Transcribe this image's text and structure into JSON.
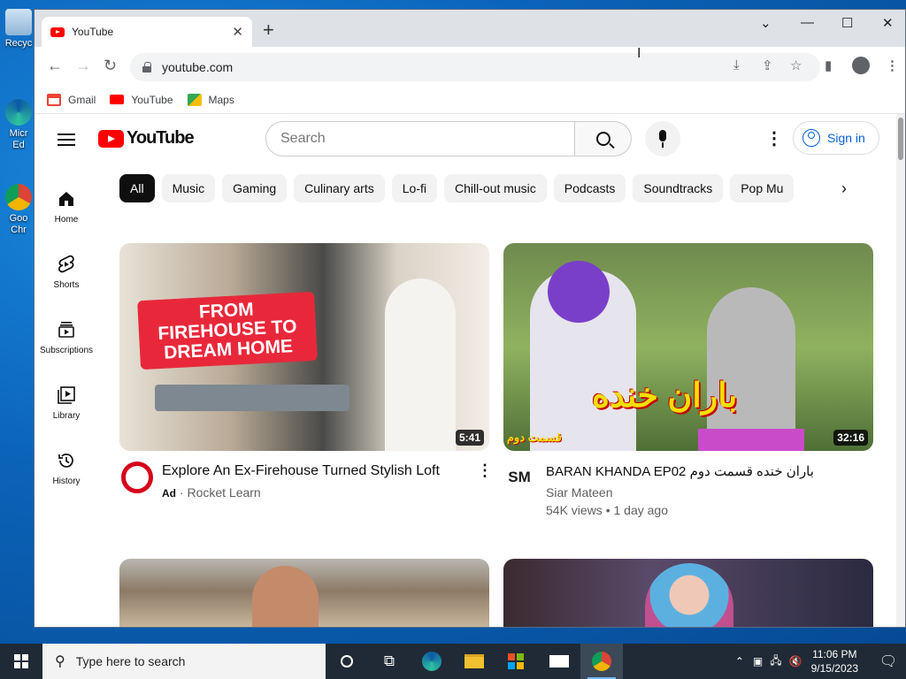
{
  "desktop": {
    "icons": [
      {
        "label": "Recyc",
        "icon": "recycle-bin-icon"
      },
      {
        "label": "Micr\nEd",
        "icon": "edge-icon"
      },
      {
        "label": "Goo\nChr",
        "icon": "chrome-icon"
      }
    ]
  },
  "browser": {
    "tab_title": "YouTube",
    "url": "youtube.com",
    "bookmarks": [
      "Gmail",
      "YouTube",
      "Maps"
    ]
  },
  "youtube": {
    "logo_text": "YouTube",
    "search_placeholder": "Search",
    "sign_in": "Sign in",
    "sidebar": [
      {
        "label": "Home",
        "icon": "home-icon"
      },
      {
        "label": "Shorts",
        "icon": "shorts-icon"
      },
      {
        "label": "Subscriptions",
        "icon": "subscriptions-icon"
      },
      {
        "label": "Library",
        "icon": "library-icon"
      },
      {
        "label": "History",
        "icon": "history-icon"
      }
    ],
    "chips": [
      "All",
      "Music",
      "Gaming",
      "Culinary arts",
      "Lo-fi",
      "Chill-out music",
      "Podcasts",
      "Soundtracks",
      "Pop Mu"
    ],
    "videos": [
      {
        "title": "Explore An Ex-Firehouse Turned Stylish Loft",
        "ad_label": "Ad",
        "channel": "Rocket Learn",
        "duration": "5:41",
        "thumb_text": "FROM FIREHOUSE TO DREAM HOME"
      },
      {
        "title": "BARAN KHANDA EP02 باران خنده قسمت دوم",
        "channel": "Siar Mateen",
        "stats": "54K views • 1 day ago",
        "duration": "32:16",
        "thumb_text": "باران خنده",
        "thumb_subtext": "قسمت دوم"
      }
    ]
  },
  "taskbar": {
    "search_placeholder": "Type here to search",
    "time": "11:06 PM",
    "date": "9/15/2023"
  }
}
